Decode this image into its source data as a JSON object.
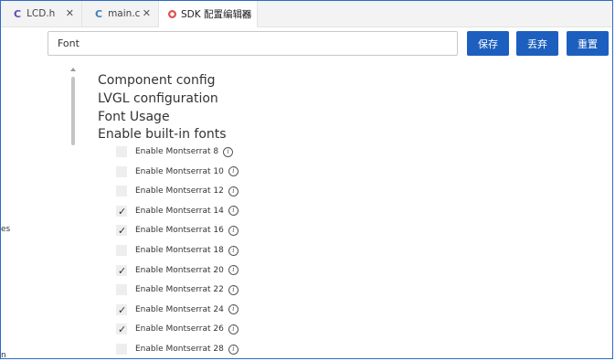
{
  "tabs": [
    {
      "icon": "C",
      "label": "LCD.h",
      "close": "✕"
    },
    {
      "icon": "C",
      "label": "main.c",
      "close": "✕"
    },
    {
      "icon": "settings",
      "label": "SDK 配置编辑器",
      "close": "✕"
    }
  ],
  "search": {
    "value": "Font"
  },
  "toolbar": {
    "save": "保存",
    "discard": "丢弃",
    "reset": "重置"
  },
  "edge": {
    "text1": "es",
    "text2": "n"
  },
  "sections": [
    "Component config",
    "LVGL configuration",
    "Font Usage",
    "Enable built-in fonts"
  ],
  "options": [
    {
      "label": "Enable Montserrat 8",
      "checked": false
    },
    {
      "label": "Enable Montserrat 10",
      "checked": false
    },
    {
      "label": "Enable Montserrat 12",
      "checked": false
    },
    {
      "label": "Enable Montserrat 14",
      "checked": true
    },
    {
      "label": "Enable Montserrat 16",
      "checked": true
    },
    {
      "label": "Enable Montserrat 18",
      "checked": false
    },
    {
      "label": "Enable Montserrat 20",
      "checked": true
    },
    {
      "label": "Enable Montserrat 22",
      "checked": false
    },
    {
      "label": "Enable Montserrat 24",
      "checked": true
    },
    {
      "label": "Enable Montserrat 26",
      "checked": true
    },
    {
      "label": "Enable Montserrat 28",
      "checked": false
    }
  ],
  "check_glyph": "✓",
  "info_glyph": "i",
  "colors": {
    "accent": "#1d5fbe",
    "window_border": "#2b6cc8"
  }
}
